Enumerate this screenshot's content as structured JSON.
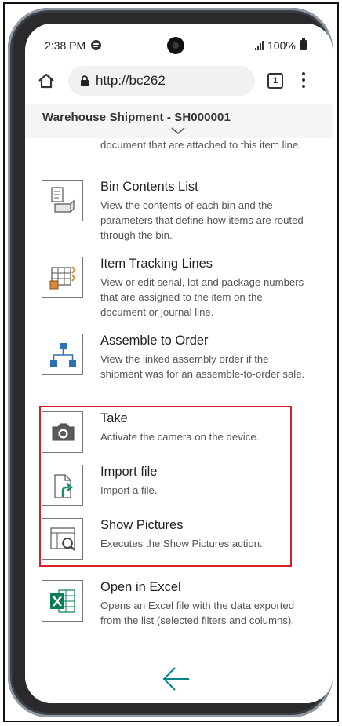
{
  "status_bar": {
    "time": "2:38 PM",
    "battery": "100%"
  },
  "browser": {
    "url": "http://bc262",
    "tab_count": "1"
  },
  "page": {
    "title": "Warehouse Shipment - SH000001"
  },
  "partial_item": {
    "description": "document that are attached to this item line."
  },
  "actions": [
    {
      "title": "Bin Contents List",
      "description": "View the contents of each bin and the parameters that define how items are routed through the bin.",
      "icon": "bin-contents-icon"
    },
    {
      "title": "Item Tracking Lines",
      "description": "View or edit serial, lot and package numbers that are assigned to the item on the document or journal line.",
      "icon": "item-tracking-icon"
    },
    {
      "title": "Assemble to Order",
      "description": "View the linked assembly order if the shipment was for an assemble-to-order sale.",
      "icon": "hierarchy-icon"
    },
    {
      "title": "Take",
      "description": "Activate the camera on the device.",
      "icon": "camera-icon"
    },
    {
      "title": "Import file",
      "description": "Import a file.",
      "icon": "import-file-icon"
    },
    {
      "title": "Show Pictures",
      "description": "Executes the Show Pictures action.",
      "icon": "show-pictures-icon"
    },
    {
      "title": "Open in Excel",
      "description": "Opens an Excel file with the data exported from the list (selected filters and columns).",
      "icon": "excel-icon"
    }
  ],
  "colors": {
    "highlight": "#d61f26",
    "accent": "#00838f",
    "excel_green": "#0a7d55",
    "icon_blue": "#2f6fb3"
  }
}
